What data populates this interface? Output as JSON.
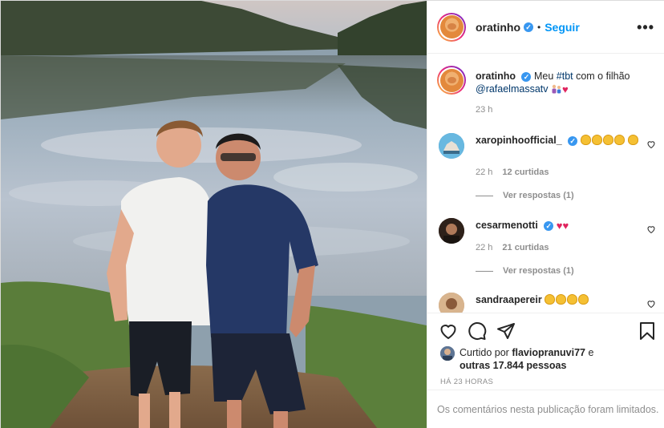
{
  "post": {
    "username": "oratinho",
    "verified_mark": "✓",
    "separator": "•",
    "follow_label": "Seguir",
    "more_label": "•••"
  },
  "caption": {
    "username": "oratinho",
    "text_before": "Meu ",
    "hashtag": "#tbt",
    "text_mid": " com o filhão",
    "mention": "@rafaelmassatv",
    "time": "23 h"
  },
  "comments": [
    {
      "username": "xaropinhoofficial_",
      "claps": 5,
      "hearts": 0,
      "time": "22 h",
      "likes": "12 curtidas",
      "replies": "Ver respostas (1)"
    },
    {
      "username": "cesarmenotti",
      "claps": 0,
      "hearts": 2,
      "time": "22 h",
      "likes": "21 curtidas",
      "replies": "Ver respostas (1)"
    },
    {
      "username": "sandraapereir",
      "claps": 4,
      "hearts": 0
    }
  ],
  "likes": {
    "prefix": "Curtido por ",
    "user": "flaviopranuvi77",
    "mid": " e",
    "others": "outras 17.844 pessoas"
  },
  "timestamp": "HÁ 23 HORAS",
  "comments_limited": "Os comentários nesta publicação foram limitados.",
  "icons": [
    "heart-icon",
    "comment-icon",
    "share-icon",
    "bookmark-icon",
    "more-icon"
  ],
  "colors": {
    "accent": "#0095f6",
    "verified": "#3897f0",
    "muted": "#8e8e8e",
    "heart": "#e0245e"
  }
}
